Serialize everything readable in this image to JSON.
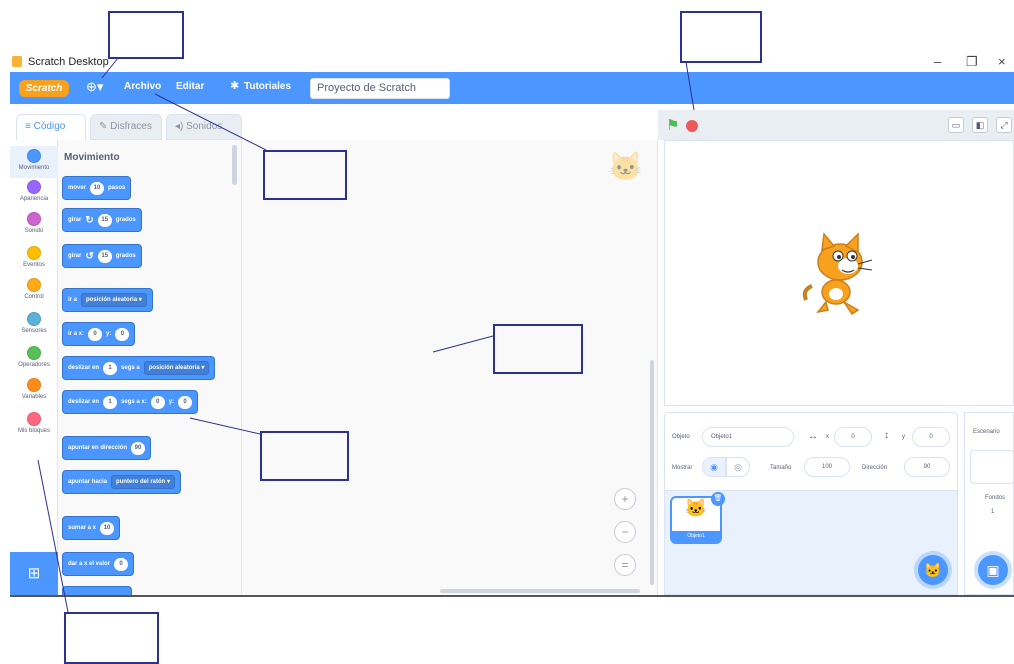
{
  "window": {
    "title": "Scratch Desktop",
    "controls": [
      "–",
      "❐",
      "×"
    ]
  },
  "menubar": {
    "logo": "Scratch",
    "language_icon": "globe-icon",
    "file": "Archivo",
    "edit": "Editar",
    "tutorials": "Tutoriales",
    "project_title": "Proyecto de Scratch"
  },
  "tabs": {
    "code": "Código",
    "costumes": "Disfraces",
    "sounds": "Sonidos"
  },
  "categories": [
    {
      "label": "Movimiento",
      "color": "#4c97ff"
    },
    {
      "label": "Apariencia",
      "color": "#9966ff"
    },
    {
      "label": "Sonido",
      "color": "#cf63cf"
    },
    {
      "label": "Eventos",
      "color": "#ffbf00"
    },
    {
      "label": "Control",
      "color": "#ffab19"
    },
    {
      "label": "Sensores",
      "color": "#5cb1d6"
    },
    {
      "label": "Operadores",
      "color": "#59c059"
    },
    {
      "label": "Variables",
      "color": "#ff8c1a"
    },
    {
      "label": "Mis bloques",
      "color": "#ff6680"
    }
  ],
  "palette": {
    "title": "Movimiento",
    "move": {
      "a": "mover",
      "n": "10",
      "b": "pasos"
    },
    "turn_right": {
      "a": "girar",
      "n": "15",
      "b": "grados"
    },
    "turn_left": {
      "a": "girar",
      "n": "15",
      "b": "grados"
    },
    "goto": {
      "a": "ir a",
      "dd": "posición aleatoria ▾"
    },
    "goto_xy": {
      "a": "ir a x:",
      "x": "0",
      "b": "y:",
      "y": "0"
    },
    "glide_to": {
      "a": "deslizar en",
      "n": "1",
      "b": "segs a",
      "dd": "posición aleatoria ▾"
    },
    "glide_xy": {
      "a": "deslizar en",
      "n": "1",
      "b": "segs a x:",
      "x": "0",
      "c": "y:",
      "y": "0"
    },
    "point_dir": {
      "a": "apuntar en dirección",
      "n": "90"
    },
    "point_to": {
      "a": "apuntar hacia",
      "dd": "puntero del ratón ▾"
    },
    "change_x": {
      "a": "sumar a x",
      "n": "10"
    },
    "set_x": {
      "a": "dar a x el valor",
      "n": "0"
    }
  },
  "zoom": {
    "in": "+",
    "out": "−",
    "reset": "="
  },
  "sprite_info": {
    "sprite_label": "Objeto",
    "sprite_name": "Objeto1",
    "x_label": "x",
    "x_value": "0",
    "y_label": "y",
    "y_value": "0",
    "show_label": "Mostrar",
    "size_label": "Tamaño",
    "size_value": "100",
    "direction_label": "Dirección",
    "direction_value": "90"
  },
  "sprite_list": {
    "thumb_name": "Objeto1"
  },
  "stage_panel": {
    "title": "Escenario",
    "backdrops_label": "Fondos",
    "backdrops_count": "1"
  }
}
